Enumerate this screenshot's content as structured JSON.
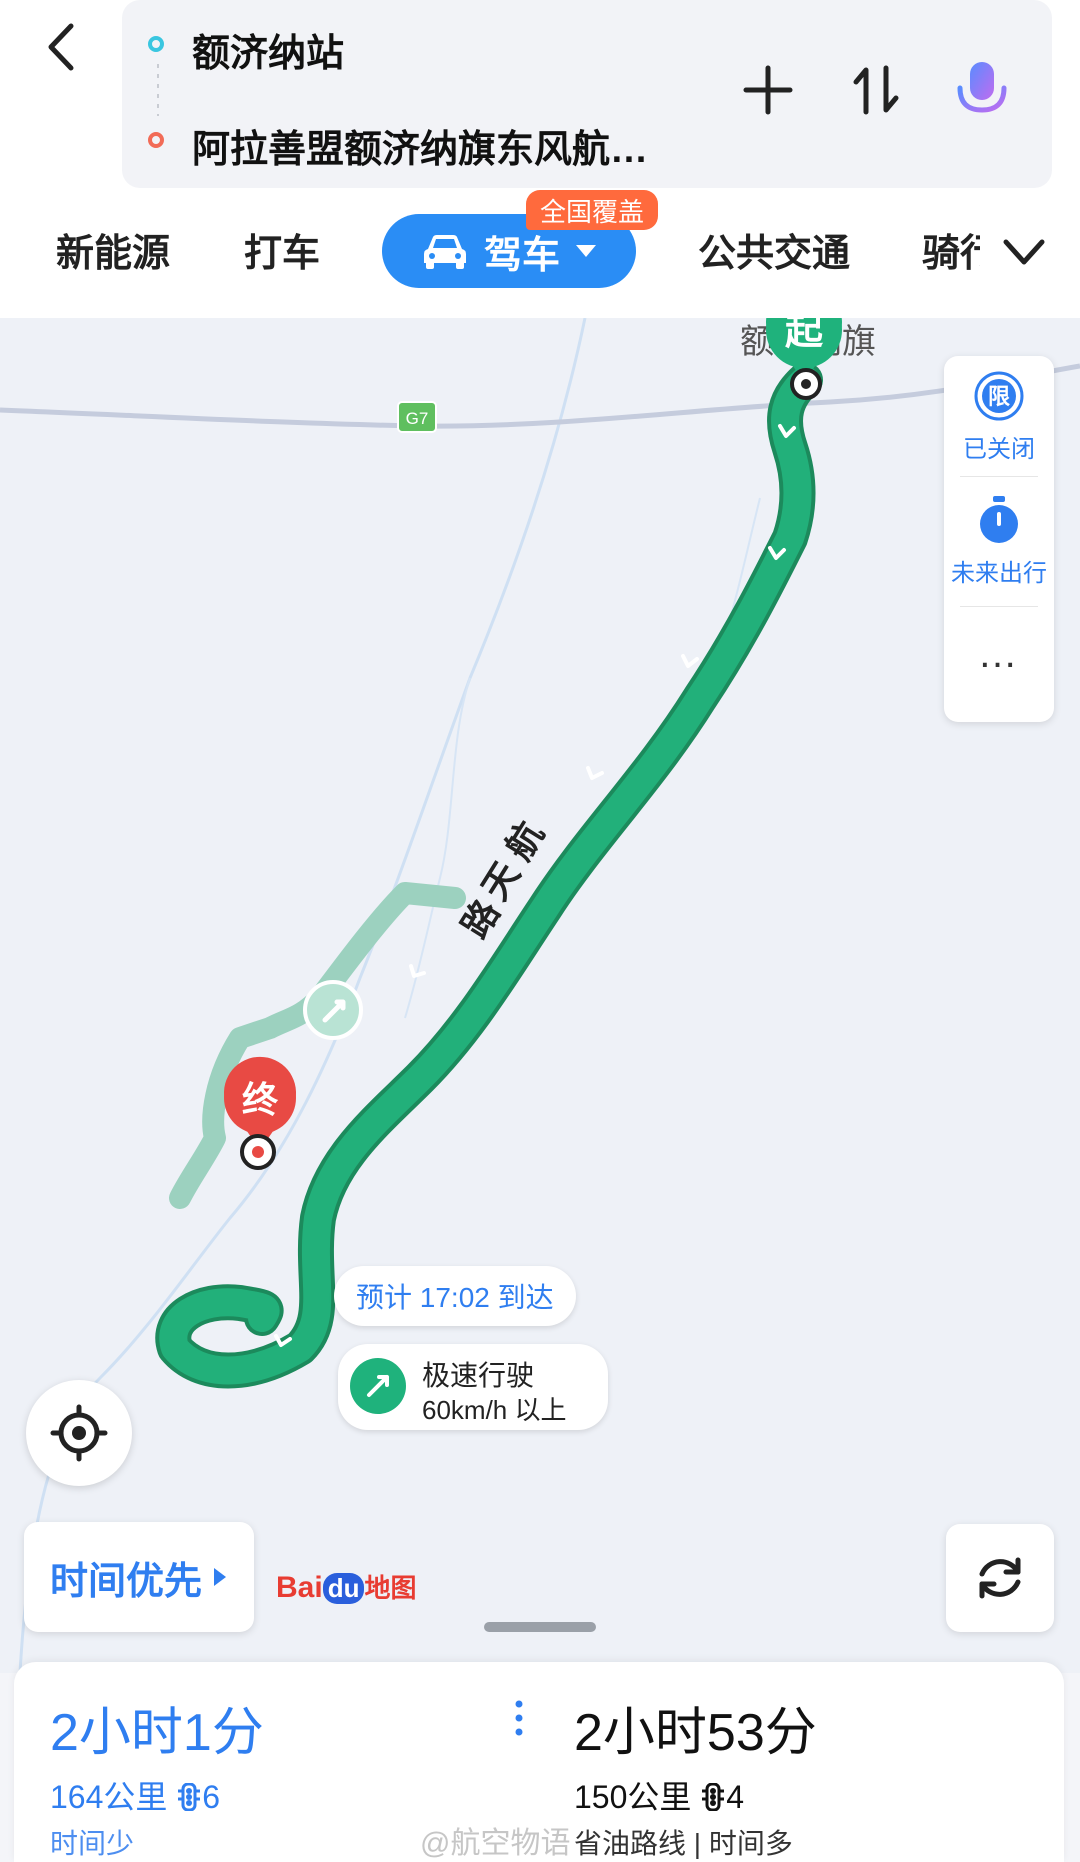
{
  "header": {
    "origin": "额济纳站",
    "destination": "阿拉善盟额济纳旗东风航…"
  },
  "modes": {
    "new_energy": "新能源",
    "taxi": "打车",
    "drive": "驾车",
    "drive_badge": "全国覆盖",
    "transit": "公共交通",
    "bike": "骑行"
  },
  "map": {
    "highway_shield": "G7",
    "place_label": "额济纳旗",
    "start_pin": "起",
    "end_pin": "终",
    "road_name_1": "航",
    "road_name_2": "天",
    "road_name_3": "路",
    "eta": "预计 17:02 到达",
    "speed_title": "极速行驶",
    "speed_detail": "60km/h 以上",
    "route_color": "#1fb27c",
    "alt_route_color": "#9cd1bf"
  },
  "side_panel": {
    "limit_icon_text": "限",
    "limit_label": "已关闭",
    "future_label": "未来出行",
    "more": "…"
  },
  "controls": {
    "time_priority": "时间优先",
    "logo_bai": "Bai",
    "logo_du": "du",
    "logo_map": "地图"
  },
  "plans": [
    {
      "time": "2小时1分",
      "distance": "164公里",
      "lights": "6",
      "tag": "时间少"
    },
    {
      "time": "2小时53分",
      "distance": "150公里",
      "lights": "4",
      "tag": "省油路线 | 时间多"
    }
  ],
  "watermark": "@航空物语"
}
